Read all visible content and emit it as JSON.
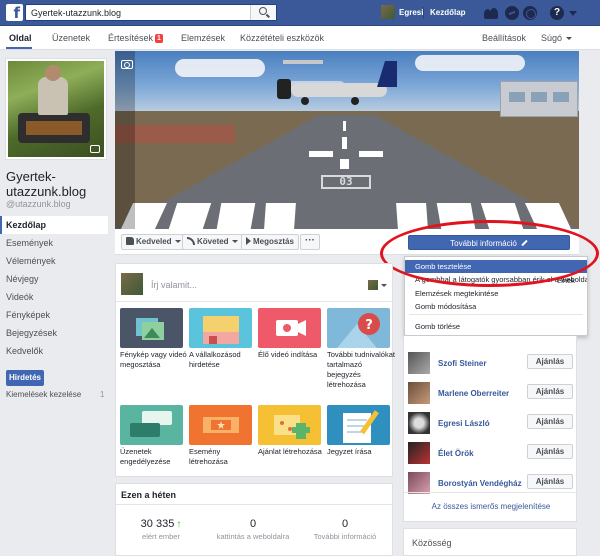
{
  "topbar": {
    "search_value": "Gyertek-utazzunk.blog",
    "user_name": "Egresi",
    "home_label": "Kezdőlap"
  },
  "tabs": [
    {
      "label": "Oldal",
      "active": true
    },
    {
      "label": "Üzenetek"
    },
    {
      "label": "Értesítések",
      "badge": "1"
    },
    {
      "label": "Elemzések"
    },
    {
      "label": "Közzétételi eszközök"
    },
    {
      "label": "Beállítások"
    },
    {
      "label": "Súgó"
    }
  ],
  "page": {
    "name": "Gyertek-utazzunk.blog",
    "handle": "@utazzunk.blog"
  },
  "leftnav": {
    "items": [
      "Kezdőlap",
      "Események",
      "Vélemények",
      "Névjegy",
      "Videók",
      "Fényképek",
      "Bejegyzések",
      "Kedvelők"
    ],
    "promote_label": "Hirdetés",
    "manage_ads_label": "Kiemelések kezelése",
    "manage_ads_count": "1"
  },
  "cover": {
    "runway_number": "03"
  },
  "actions": {
    "like_label": "Kedveled",
    "follow_label": "Követed",
    "share_label": "Megosztás",
    "more_label": "···",
    "cta_label": "További információ"
  },
  "dropdown": {
    "items": [
      {
        "label": "Gomb tesztelése",
        "highlighted": true
      },
      {
        "label": "A gombbal a látogatók gyorsabban érik el a weboldalt."
      },
      {
        "label": "Elemzések megtekintése"
      },
      {
        "label": "Gomb módosítása"
      },
      {
        "label": "Gomb törlése"
      }
    ],
    "overflow_text": "elnek"
  },
  "composer": {
    "placeholder": "Írj valamit...",
    "tiles": [
      {
        "label": "Fénykép vagy videó megosztása",
        "color": "#4a5568"
      },
      {
        "label": "A vállalkozásod hirdetése",
        "color": "#59c4dc"
      },
      {
        "label": "Élő videó indítása",
        "color": "#ef5a6b"
      },
      {
        "label": "További tudnivalókat tartalmazó bejegyzés létrehozása",
        "color": "#7fb8d8"
      },
      {
        "label": "Üzenetek engedélyezése",
        "color": "#5ab5a0"
      },
      {
        "label": "Esemény létrehozása",
        "color": "#f0742f"
      },
      {
        "label": "Ajánlat létrehozása",
        "color": "#f5c034"
      },
      {
        "label": "Jegyzet írása",
        "color": "#2f8fbf"
      }
    ]
  },
  "stats": {
    "title": "Ezen a héten",
    "items": [
      {
        "value": "30 335",
        "label": "elért ember",
        "trend": "↑"
      },
      {
        "value": "0",
        "label": "kattintás a weboldalra"
      },
      {
        "value": "0",
        "label": "További információ"
      }
    ]
  },
  "invites": {
    "button_label": "Ajánlás",
    "friends": [
      {
        "name": "Szofi Steiner"
      },
      {
        "name": "Marlene Oberreiter"
      },
      {
        "name": "Egresi László"
      },
      {
        "name": "Élet Örök"
      },
      {
        "name": "Borostyán Vendégház"
      }
    ],
    "see_all_label": "Az összes ismerős megjelenítése"
  },
  "community": {
    "title": "Közösség"
  },
  "colors": {
    "fb_blue": "#3b5998",
    "button_blue": "#4267b2",
    "link_blue": "#365899",
    "highlight_red": "#e0141e"
  }
}
